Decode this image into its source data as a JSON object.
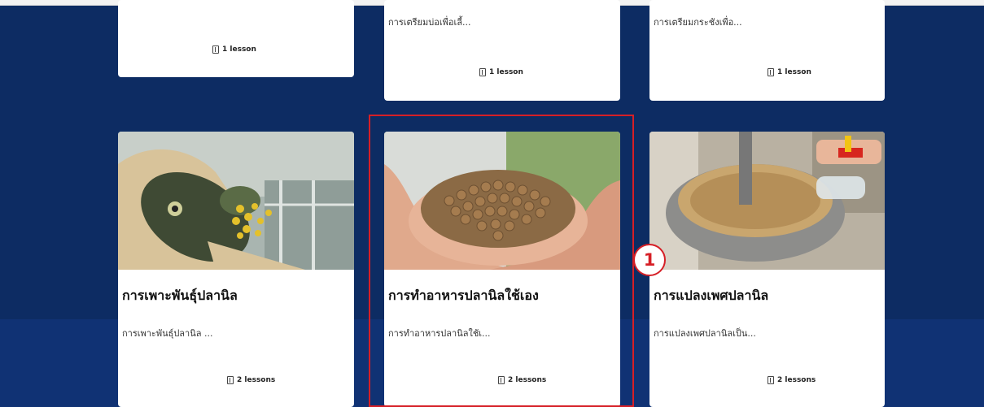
{
  "top_cards": [
    {
      "description": "",
      "lessons": "1 lesson"
    },
    {
      "description": "การเตรียมบ่อเพื่อเลี้...",
      "lessons": "1 lesson"
    },
    {
      "description": "การเตรียมกระชังเพื่อ...",
      "lessons": "1 lesson"
    }
  ],
  "courses": [
    {
      "title": "การเพาะพันธุ์ปลานิล",
      "description": "การเพาะพันธุ์ปลานิล ...",
      "lessons": "2 lessons",
      "image": "fish-eggs-image"
    },
    {
      "title": "การทำอาหารปลานิลใช้เอง",
      "description": "การทำอาหารปลานิลใช้เ...",
      "lessons": "2 lessons",
      "image": "fish-feed-pellets-image"
    },
    {
      "title": "การแปลงเพศปลานิล",
      "description": "การแปลงเพศปลานิลเป็น...",
      "lessons": "2 lessons",
      "image": "hormone-mixing-image"
    }
  ],
  "annotation": {
    "step_number": "1",
    "color": "#d61f26"
  },
  "colors": {
    "background": "#0d2c63",
    "card": "#ffffff"
  }
}
